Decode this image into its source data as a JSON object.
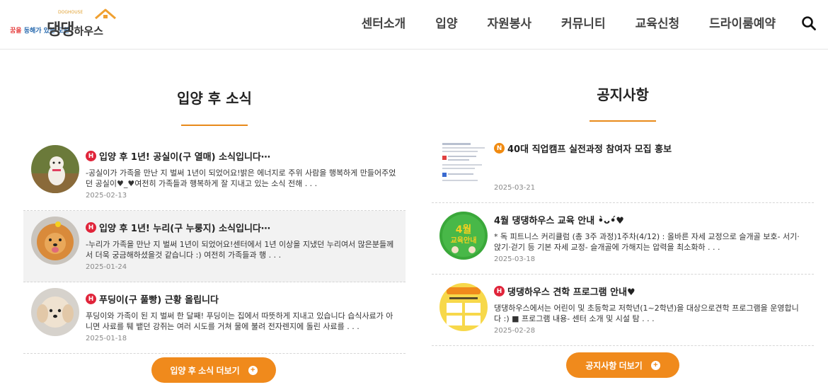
{
  "header": {
    "logo_tag_a": "꿈을",
    "logo_tag_b": "동해가 있는 도원",
    "logo_brand": "댕댕",
    "logo_brand_small": "하우스",
    "logo_sub": "DOGHOUSE",
    "nav": [
      "센터소개",
      "입양",
      "자원봉사",
      "커뮤니티",
      "교육신청",
      "드라이룸예약"
    ]
  },
  "adoption": {
    "title": "입양 후 소식",
    "more_label": "입양 후 소식 더보기",
    "items": [
      {
        "badge": "H",
        "title": "입양 후 1년! 공실이(구 열매) 소식입니다⋯",
        "desc": " -공실이가 가족을 만난 지 벌써 1년이 되었어요!밝은 에너지로 주위 사람을 행복하게 만들어주었던 공실이♥_♥여전히 가족들과 행복하게 잘 지내고 있는 소식 전해 . . .",
        "date": "2025-02-13"
      },
      {
        "badge": "H",
        "title": "입양 후 1년! 누리(구 누룽지) 소식입니다⋯",
        "desc": " -누리가 가족을 만난 지 벌써 1년이 되었어요!센터에서 1년 이상을 지냈던 누리여서 많은분들께서 더욱 궁금해하셨을것 같습니다 :) 여전히 가족들과 행 . . .",
        "date": "2025-01-24"
      },
      {
        "badge": "H",
        "title": "푸딩이(구 풀빵) 근황 올립니다",
        "desc": "푸딩이와 가족이 된 지 벌써 한 달째! 푸딩이는 집에서 따뜻하게 지내고 있습니다 습식사료가 아니면 사료를 퉤 뱉던 강쥐는 여러 시도를 거쳐 물에 불려 전자렌지에 돌린 사료를 . . .",
        "date": "2025-01-18"
      }
    ]
  },
  "notice": {
    "title": "공지사항",
    "more_label": "공지사항 더보기",
    "items": [
      {
        "badge": "N",
        "title": "40대 직업캠프 실전과정 참여자 모집 홍보",
        "desc": "",
        "date": "2025-03-21"
      },
      {
        "badge": "",
        "title": "4월 댕댕하우스 교육 안내 •̀ᴗ•́♥",
        "desc": " * 독 피트니스 커리큘럼 (총 3주 과정)1주차(4/12) : 올바른 자세 교정으로 슬개골 보호- 서기·앉기·걷기 등 기본 자세 교정- 슬개골에 가해지는 압력을 최소화하 . . .",
        "date": "2025-03-18",
        "thumb_text_a": "4월",
        "thumb_text_b": "교육안내"
      },
      {
        "badge": "H",
        "title": "댕댕하우스 견학 프로그램 안내♥",
        "desc": " 댕댕하우스에서는  어린이 및 초등학교 저학년(1~2학년)을 대상으로견학 프로그램을 운영합니다 :) ■ 프로그램 내용- 센터 소개 및 시설 탐 . . .",
        "date": "2025-02-28"
      }
    ]
  },
  "colors": {
    "accent": "#f08a1c",
    "badge_h": "#e0243a",
    "badge_n": "#f08a10"
  },
  "icons": {
    "search": "search-icon",
    "plus": "plus-circle-icon"
  }
}
